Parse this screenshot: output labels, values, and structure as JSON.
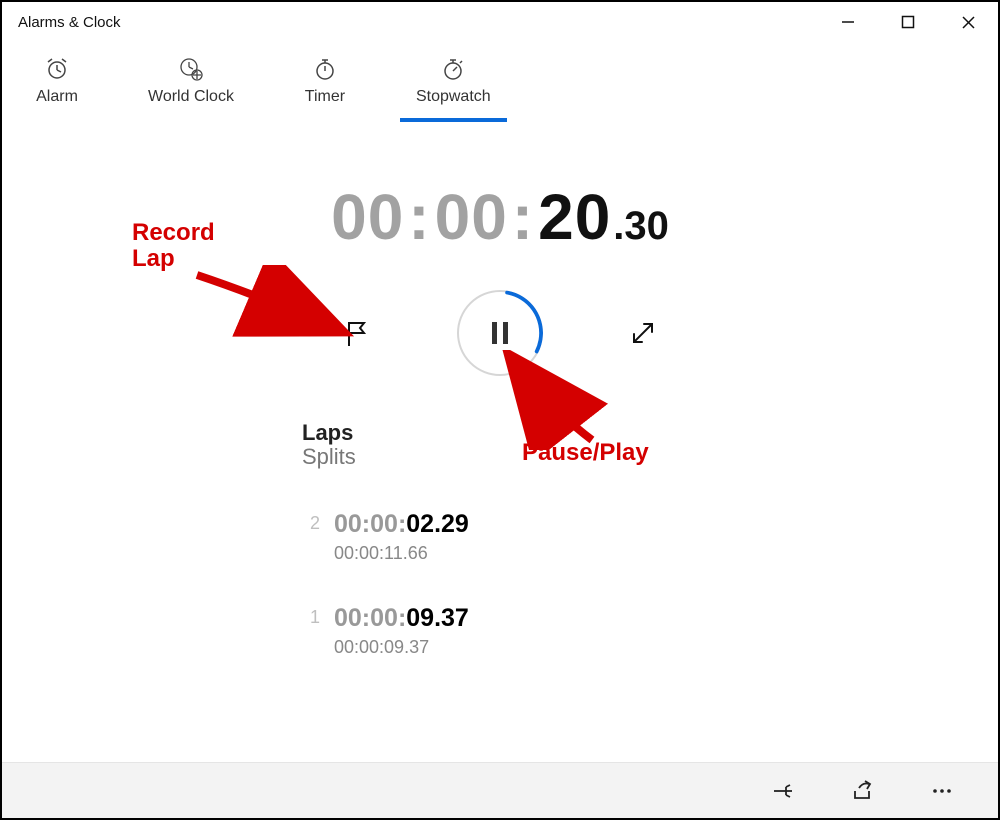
{
  "window": {
    "title": "Alarms & Clock"
  },
  "tabs": [
    {
      "key": "alarm",
      "label": "Alarm"
    },
    {
      "key": "world-clock",
      "label": "World Clock"
    },
    {
      "key": "timer",
      "label": "Timer"
    },
    {
      "key": "stopwatch",
      "label": "Stopwatch",
      "active": true
    }
  ],
  "stopwatch": {
    "hours": "00",
    "minutes": "00",
    "seconds": "20",
    "subseconds": ".30"
  },
  "laps": {
    "header1": "Laps",
    "header2": "Splits",
    "rows": [
      {
        "index": "2",
        "lap_dim": "00:00:",
        "lap_bold": "02.29",
        "split": "00:00:11.66"
      },
      {
        "index": "1",
        "lap_dim": "00:00:",
        "lap_bold": "09.37",
        "split": "00:00:09.37"
      }
    ]
  },
  "annotations": {
    "record_lap_line1": "Record",
    "record_lap_line2": "Lap",
    "pause_play": "Pause/Play"
  },
  "colors": {
    "accent": "#0a6ad9",
    "anno": "#d40000"
  }
}
